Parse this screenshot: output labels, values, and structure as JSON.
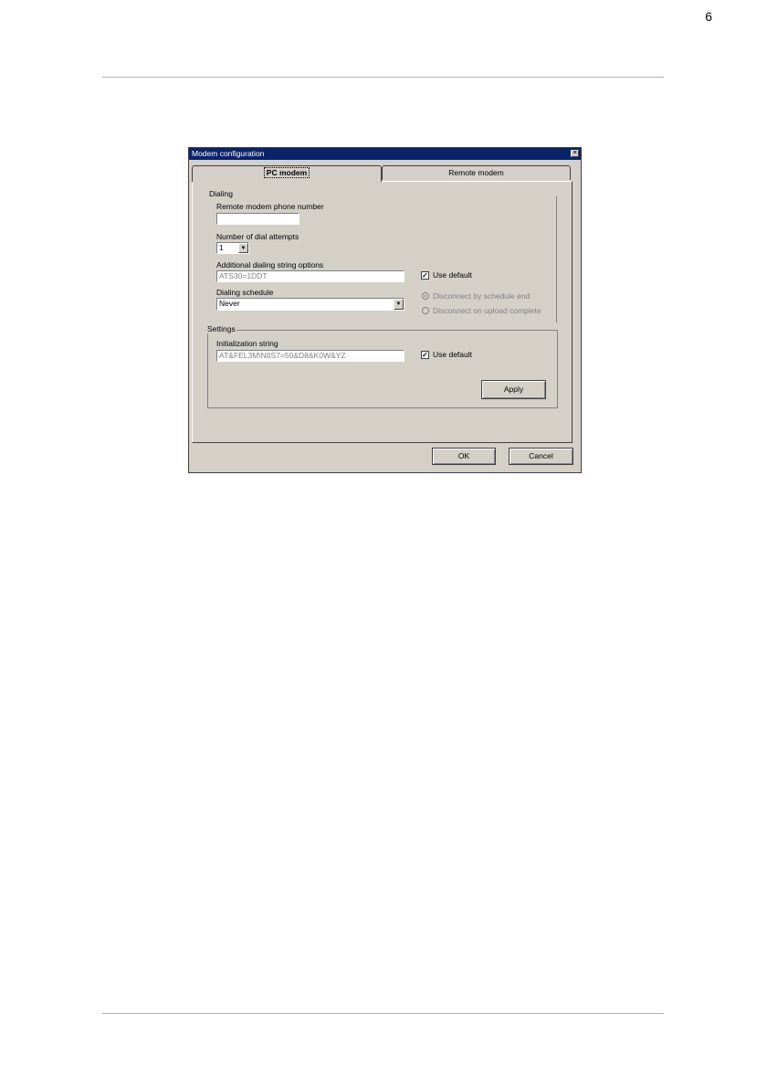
{
  "page": {
    "number": "6"
  },
  "dialog": {
    "title": "Modem configuration",
    "close_icon": "close-icon"
  },
  "tabs": [
    {
      "label": "PC modem",
      "active": true
    },
    {
      "label": "Remote modem",
      "active": false
    }
  ],
  "dialing": {
    "group_label": "Dialing",
    "phone_label": "Remote modem phone number",
    "phone_value": "",
    "attempts_label": "Number of dial attempts",
    "attempts_value": "1",
    "additional_label": "Additional dialing string options",
    "additional_value": "ATS30=1DDT",
    "additional_use_default_label": "Use default",
    "additional_use_default_checked": true,
    "schedule_label": "Dialing schedule",
    "schedule_value": "Never",
    "radio_schedule_label": "Disconnect by schedule end",
    "radio_upload_label": "Disconnect on upload complete"
  },
  "settings": {
    "group_label": "Settings",
    "init_label": "Initialization string",
    "init_value": "AT&FEL3M\\N0S7=50&D8&K0W&YZ",
    "use_default_label": "Use default",
    "use_default_checked": true,
    "apply_label": "Apply"
  },
  "footer": {
    "ok_label": "OK",
    "cancel_label": "Cancel"
  },
  "colors": {
    "titlebar": "#0a246a",
    "dialog_face": "#d4d0c8"
  }
}
